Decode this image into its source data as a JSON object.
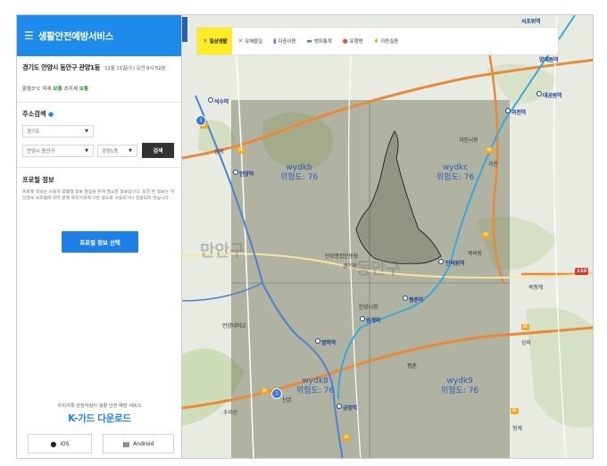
{
  "header": {
    "menu_icon": "hamburger-menu-icon",
    "title": "생활안전예방서비스"
  },
  "location": {
    "name": "경기도 안양시 동안구 관양1동",
    "datetime": "11월 11일(수) 오전 9시 52분"
  },
  "weather": {
    "temp": "맑음3°C",
    "pm10_label": "미세",
    "pm10_value": "보통",
    "pm25_label": "초미세",
    "pm25_value": "보통"
  },
  "address_search": {
    "title": "주소검색",
    "province": "경기도",
    "city": "안양시 동안구",
    "dong": "관양1동",
    "search_label": "검색"
  },
  "profile": {
    "title": "프로필 정보",
    "description": "프로필 정보는 사용자 맞춤형 정보 알림을 위해 필요한 정보입니다. 또한 본 정보는 개인정보 보호법에 따라 본래 목적이외에 다른 용도로 사용되거나 전송되지 않습니다.",
    "button_label": "프로필 정보 선택"
  },
  "kguard": {
    "caption": "우리가족 안전지킴이 생활 안전 예방 서비스",
    "title": "K-가드 다운로드",
    "ios_label": "iOS",
    "android_label": "Android"
  },
  "tabs": [
    {
      "label": "일상생활",
      "icon": "daily-life-icon",
      "color": "#2b7fe0",
      "active": true
    },
    {
      "label": "유해물질",
      "icon": "hazard-icon",
      "color": "#e54b4b",
      "active": false
    },
    {
      "label": "다중이용",
      "icon": "multi-use-icon",
      "color": "#9b59d0",
      "active": false
    },
    {
      "label": "범죄통계",
      "icon": "crime-stats-icon",
      "color": "#3a86d8",
      "active": false
    },
    {
      "label": "유행병",
      "icon": "epidemic-icon",
      "color": "#e2553c",
      "active": false
    },
    {
      "label": "자동실종",
      "icon": "missing-icon",
      "color": "#f2a516",
      "active": false
    }
  ],
  "map": {
    "grid_cells": [
      {
        "code": "wydkb",
        "risk": "위험도: 76"
      },
      {
        "code": "wydkc",
        "risk": "위험도: 76"
      },
      {
        "code": "wydk8",
        "risk": "위험도: 76"
      },
      {
        "code": "wydk9",
        "risk": "위험도: 76"
      }
    ],
    "places": {
      "beomgye": "석수역",
      "anyang_station": "안양역",
      "gwacheon_hall": "과천시청",
      "gwacheon": "과천",
      "anyang_complex": "안양종합운동장",
      "gyeonggi": "경기장",
      "indeogwon": "인덕원역",
      "anyang_city_hall": "안양시청",
      "pyeongchon_station": "평촌역",
      "beomgye_station": "범계역",
      "anyang_univ": "안양대학교",
      "myeonghak": "명학역",
      "pyeongchon": "평촌",
      "sanbon": "산본",
      "surisan": "수리산",
      "geumjeong": "금정역",
      "buk_uiwang": "북의왕",
      "bukcheonggye": "북청계",
      "cheonggye": "청계",
      "gwacheon_station": "과천역",
      "daegongwon": "대공원역",
      "seocho": "서초위역",
      "yangjae": "양재원역",
      "sangnam": "상의",
      "big_manan": "만안구",
      "big_dongan": "동안구",
      "sanghyeon": "상의"
    }
  }
}
